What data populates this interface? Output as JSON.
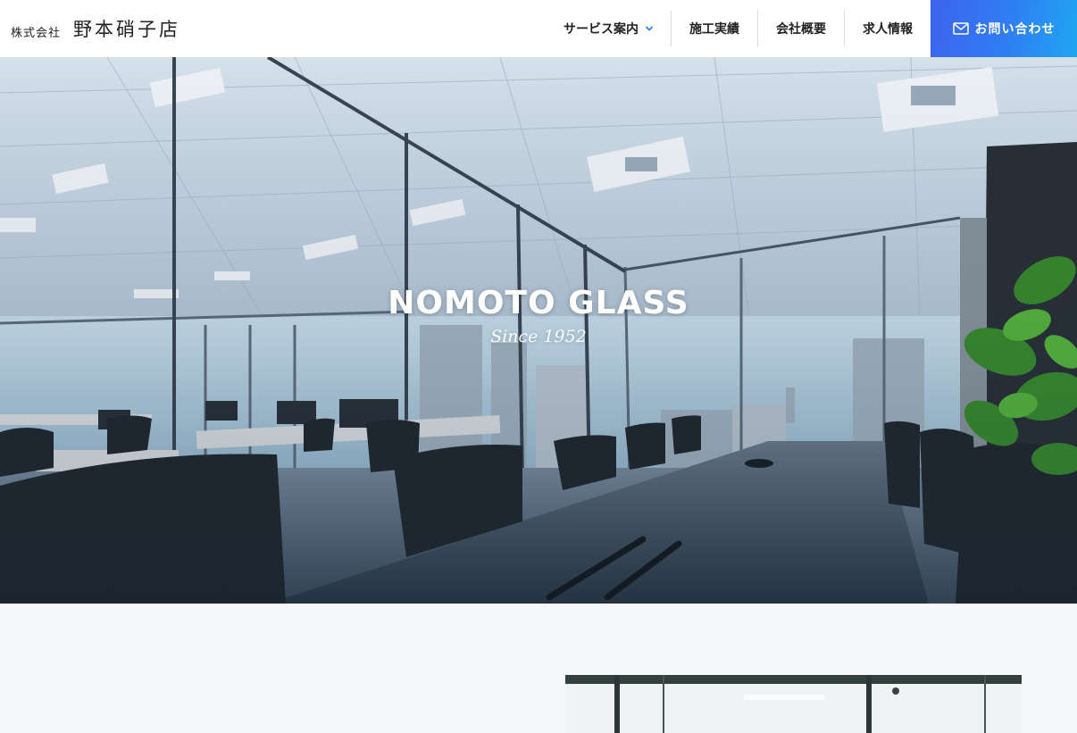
{
  "header": {
    "logo_prefix": "株式会社",
    "logo_name": "野本硝子店",
    "nav": [
      {
        "label": "サービス案内",
        "has_dropdown": true
      },
      {
        "label": "施工実績"
      },
      {
        "label": "会社概要"
      },
      {
        "label": "求人情報"
      }
    ],
    "contact_label": "お問い合わせ"
  },
  "hero": {
    "title": "NOMOTO GLASS",
    "subtitle": "Since 1952"
  },
  "colors": {
    "accent_start": "#3d63f0",
    "accent_end": "#1fa6f2",
    "nav_chevron": "#2f7ff2"
  },
  "icons": {
    "contact": "mail-icon",
    "dropdown": "chevron-down-icon"
  }
}
